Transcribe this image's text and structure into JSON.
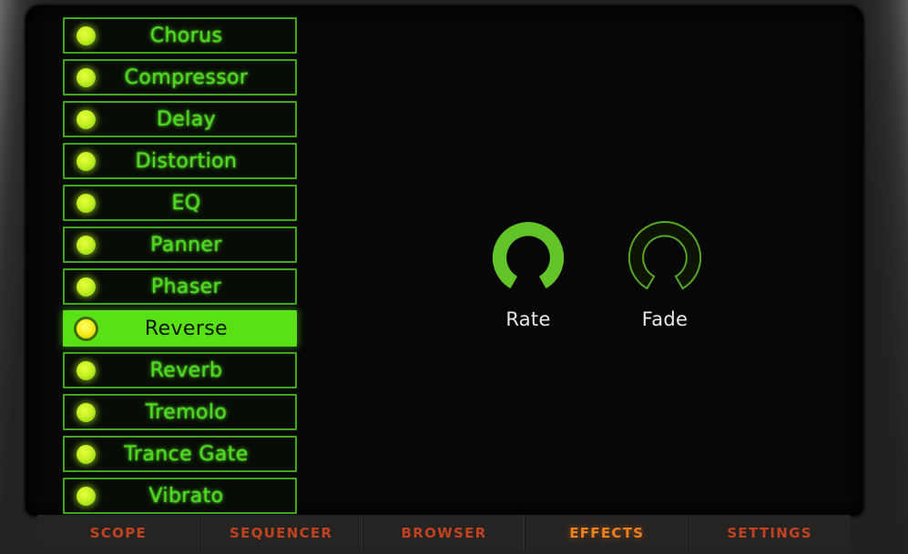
{
  "device": {
    "screen_background": "#070707",
    "bezel_color": "#2d2d2d",
    "accent_green": "#5ae116",
    "accent_orange": "#f0801c"
  },
  "effect_list": {
    "name": "effects-list",
    "items": [
      {
        "label": "Chorus",
        "led": "led-indicator",
        "selected": false
      },
      {
        "label": "Compressor",
        "led": "led-indicator",
        "selected": false
      },
      {
        "label": "Delay",
        "led": "led-indicator",
        "selected": false
      },
      {
        "label": "Distortion",
        "led": "led-indicator",
        "selected": false
      },
      {
        "label": "EQ",
        "led": "led-indicator",
        "selected": false
      },
      {
        "label": "Panner",
        "led": "led-indicator",
        "selected": false
      },
      {
        "label": "Phaser",
        "led": "led-indicator",
        "selected": false
      },
      {
        "label": "Reverse",
        "led": "led-indicator",
        "selected": true
      },
      {
        "label": "Reverb",
        "led": "led-indicator",
        "selected": false
      },
      {
        "label": "Tremolo",
        "led": "led-indicator",
        "selected": false
      },
      {
        "label": "Trance Gate",
        "led": "led-indicator",
        "selected": false
      },
      {
        "label": "Vibrato",
        "led": "led-indicator",
        "selected": false
      }
    ]
  },
  "knobs": [
    {
      "label": "Rate",
      "icon": "knob-dial-icon",
      "value": 100,
      "filled": true
    },
    {
      "label": "Fade",
      "icon": "knob-dial-icon",
      "value": 0,
      "filled": false
    }
  ],
  "tabs": [
    {
      "label": "SCOPE",
      "active": false
    },
    {
      "label": "SEQUENCER",
      "active": false
    },
    {
      "label": "BROWSER",
      "active": false
    },
    {
      "label": "EFFECTS",
      "active": true
    },
    {
      "label": "SETTINGS",
      "active": false
    }
  ]
}
